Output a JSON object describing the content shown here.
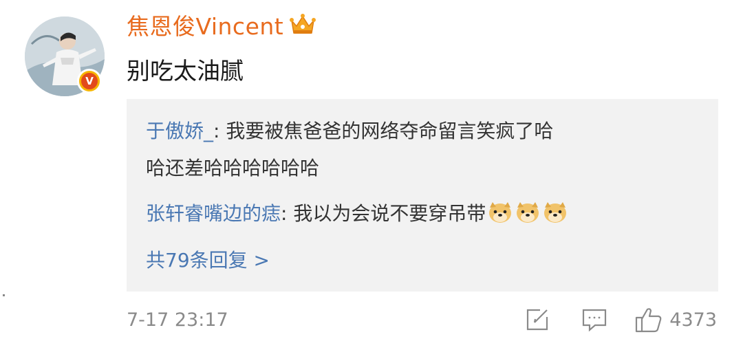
{
  "comment": {
    "username": "焦恩俊Vincent",
    "text": "别吃太油腻",
    "timestamp": "7-17 23:17",
    "like_count": "4373"
  },
  "replies": [
    {
      "user": "于傲娇_",
      "separator": ": ",
      "text_line1": "我要被焦爸爸的网络夺命留言笑疯了哈",
      "text_line2": "哈还差哈哈哈哈哈哈"
    },
    {
      "user": "张轩睿嘴边的痣",
      "separator": ": ",
      "text": "我以为会说不要穿吊带",
      "emoji_icons": [
        "doge-emoji-icon",
        "doge-emoji-icon",
        "doge-emoji-icon"
      ]
    }
  ],
  "reply_summary": "共79条回复 >",
  "icons": {
    "verified": "verified-v-icon",
    "vip": "crown-icon",
    "share": "share-edit-icon",
    "comment": "comment-bubble-icon",
    "like": "thumbs-up-icon"
  },
  "colors": {
    "username": "#e86b1e",
    "reply_user": "#4a78b3",
    "reply_bg": "#f2f2f2",
    "meta": "#8a8a8a",
    "badge_yellow": "#f7b500"
  }
}
